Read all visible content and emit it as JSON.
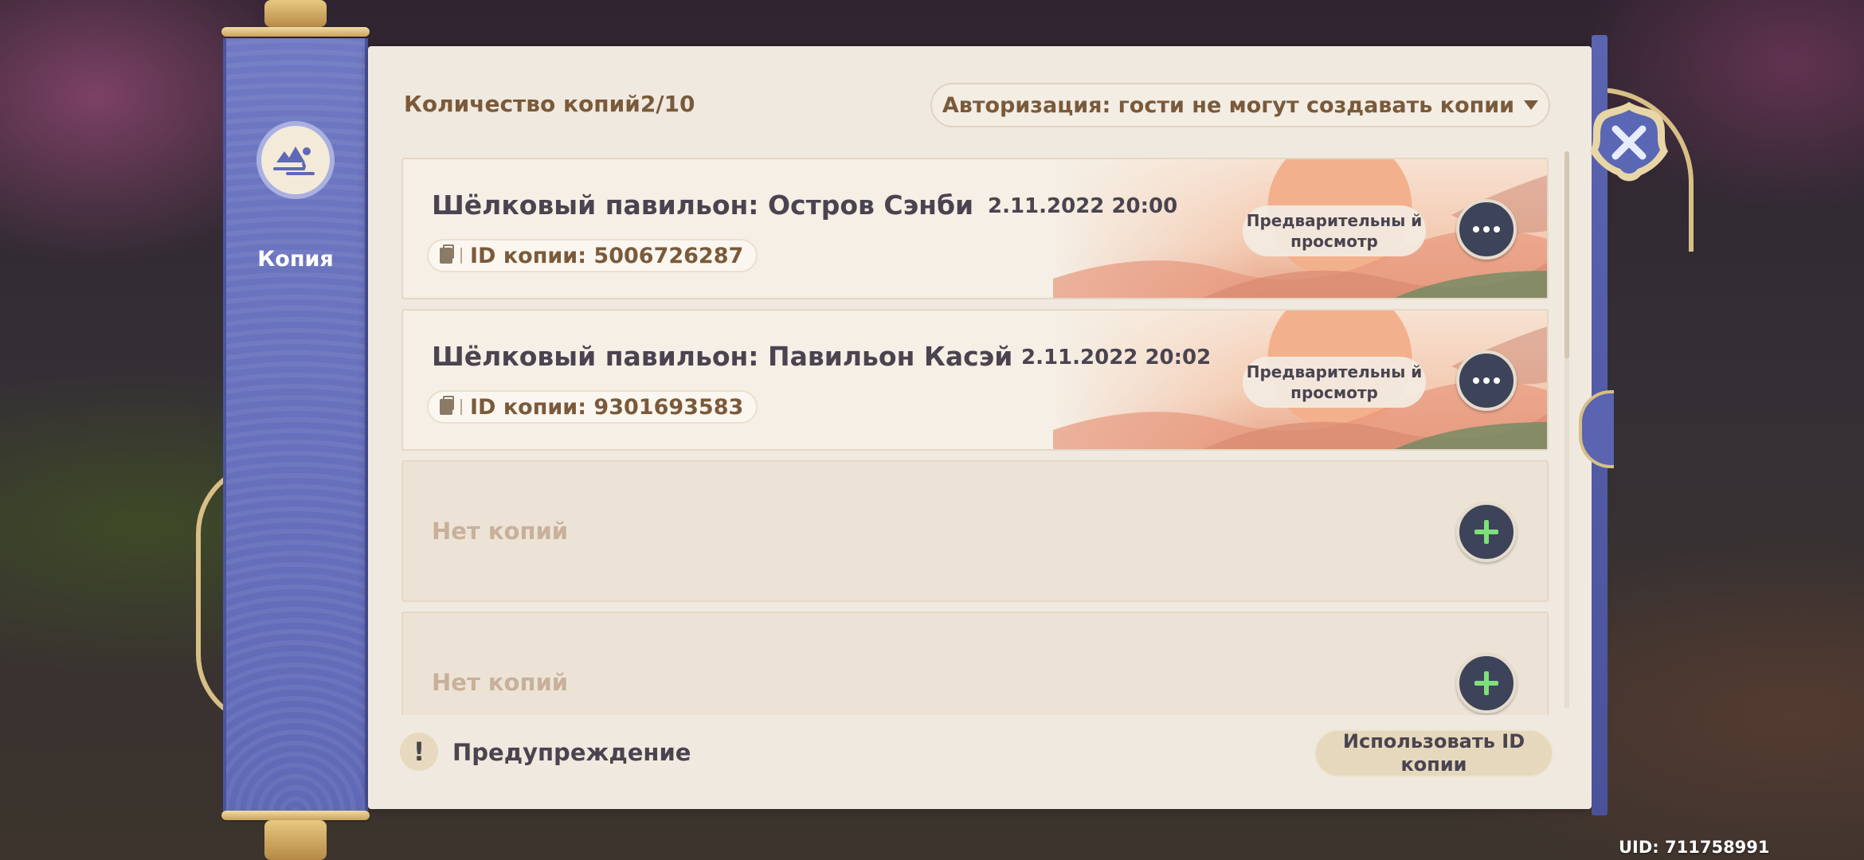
{
  "sidebar": {
    "title": "Копия",
    "icon": "copy-mountain-icon"
  },
  "header": {
    "count_label": "Количество копий2/10",
    "auth_dropdown": "Авторизация: гости не могут создавать копии"
  },
  "cards": [
    {
      "title": "Шёлковый павильон: Остров Сэнби",
      "date": "2.11.2022 20:00",
      "id_label": "ID копии: 5006726287",
      "preview": "Предварительны й просмотр"
    },
    {
      "title": "Шёлковый павильон: Павильон Касэй",
      "date": "2.11.2022 20:02",
      "id_label": "ID копии: 9301693583",
      "preview": "Предварительны й просмотр"
    }
  ],
  "empty_slots": [
    {
      "label": "Нет копий"
    },
    {
      "label": "Нет копий"
    }
  ],
  "footer": {
    "warning": "Предупреждение",
    "warning_icon": "!",
    "use_id": "Использовать ID копии"
  },
  "uid": "UID: 711758991",
  "colors": {
    "banner": "#6f78c2",
    "panel": "#f0e9df",
    "accent_text": "#7a5a3a",
    "button_dark": "#3d4358",
    "plus_green": "#7ee07a"
  }
}
